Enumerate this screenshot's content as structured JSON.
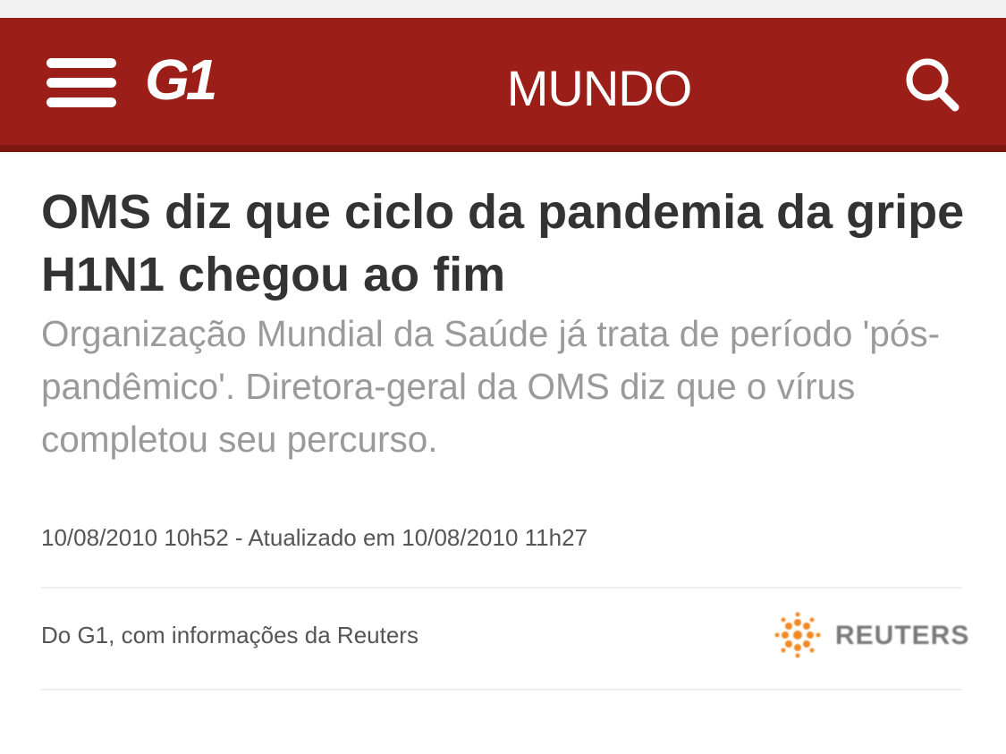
{
  "header": {
    "logo_text": "G1",
    "section_title": "MUNDO",
    "menu_icon": "hamburger-menu-icon",
    "search_icon": "search-icon",
    "background_color": "#9b1f18"
  },
  "article": {
    "headline": "OMS diz que ciclo da pandemia da gripe H1N1 chegou ao fim",
    "subtitle": "Organização Mundial da Saúde já trata de período 'pós-pandêmico'. Diretora-geral da OMS diz que o vírus completou seu percurso.",
    "dateline": "10/08/2010 10h52 - Atualizado em 10/08/2010 11h27",
    "source_credit": "Do G1, com informações da Reuters",
    "agency_logo": {
      "icon": "reuters-logo-icon",
      "text": "REUTERS",
      "accent_color": "#f08a24"
    }
  }
}
